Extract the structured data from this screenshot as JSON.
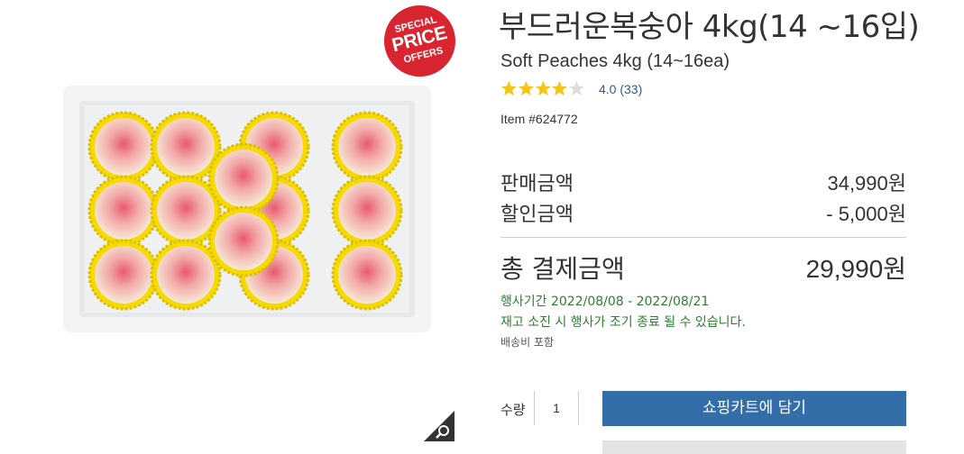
{
  "badge": {
    "line1": "SPECIAL",
    "line2": "PRICE",
    "line3": "OFFERS"
  },
  "product": {
    "title": "부드러운복숭아 4kg(14 ~16입)",
    "subtitle": "Soft Peaches 4kg (14~16ea)",
    "rating_stars": 4,
    "rating_text": "4.0 (33)",
    "item_number": "Item #624772",
    "image_icon": "peach-box-image"
  },
  "pricing": {
    "sale_label": "판매금액",
    "sale_value": "34,990원",
    "discount_label": "할인금액",
    "discount_value": "- 5,000원",
    "total_label": "총 결제금액",
    "total_value": "29,990원"
  },
  "promo": {
    "period": "행사기간 2022/08/08 - 2022/08/21",
    "notice": "재고 소진 시 행사가 조기 종료 될 수 있습니다.",
    "shipping": "배송비 포함"
  },
  "purchase": {
    "qty_label": "수량",
    "qty_value": "1",
    "cart_button": "쇼핑카트에 담기"
  },
  "colors": {
    "accent": "#336ea8",
    "badge": "#d9252f",
    "promo_text": "#2e7d32",
    "star": "#f5c518"
  }
}
